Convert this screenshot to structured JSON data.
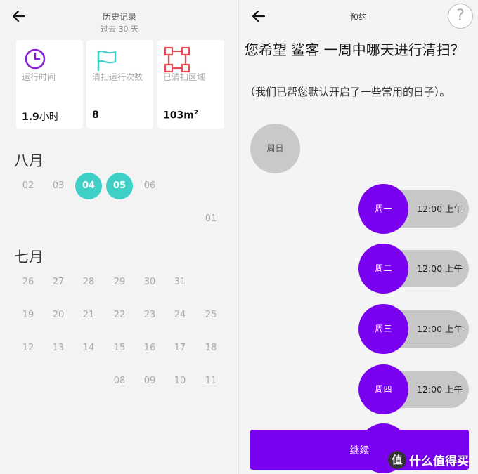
{
  "left": {
    "header": {
      "title": "历史记录",
      "subtitle": "过去 30 天"
    },
    "stats": [
      {
        "icon": "clock-icon",
        "label": "运行时间",
        "value_num": "1.9",
        "value_unit": "小时",
        "color": "#8a1fd4"
      },
      {
        "icon": "flag-icon",
        "label": "清扫运行次数",
        "value_num": "8",
        "value_unit": "",
        "color": "#3ecfc7"
      },
      {
        "icon": "area-icon",
        "label": "已清扫区域",
        "value_num": "103m",
        "value_unit": "2",
        "color": "#e84a55"
      }
    ],
    "aug": {
      "label": "八月",
      "row1": [
        "02",
        "03",
        "04",
        "05",
        "06"
      ],
      "row2": [
        "01"
      ]
    },
    "jul": {
      "label": "七月",
      "row1": [
        "26",
        "27",
        "28",
        "29",
        "30",
        "31"
      ],
      "row2": [
        "19",
        "20",
        "21",
        "22",
        "23",
        "24",
        "25"
      ],
      "row3": [
        "12",
        "13",
        "14",
        "15",
        "16",
        "17",
        "18"
      ],
      "row4": [
        "08",
        "09",
        "10",
        "11"
      ]
    },
    "selected_color": "#3ecfc7"
  },
  "right": {
    "header": {
      "title": "预约",
      "help": "?"
    },
    "question": "您希望 鲨客 一周中哪天进行清扫？",
    "note": "（我们已帮您默认开启了一些常用的日子）。",
    "day_off": "周日",
    "days": [
      {
        "name": "周一",
        "time": "12:00 上午"
      },
      {
        "name": "周二",
        "time": "12:00 上午"
      },
      {
        "name": "周三",
        "time": "12:00 上午"
      },
      {
        "name": "周四",
        "time": "12:00 上午"
      }
    ],
    "continue_label": "继续",
    "accent": "#7a00f0"
  },
  "watermark": {
    "logo": "值",
    "text": "什么值得买"
  }
}
